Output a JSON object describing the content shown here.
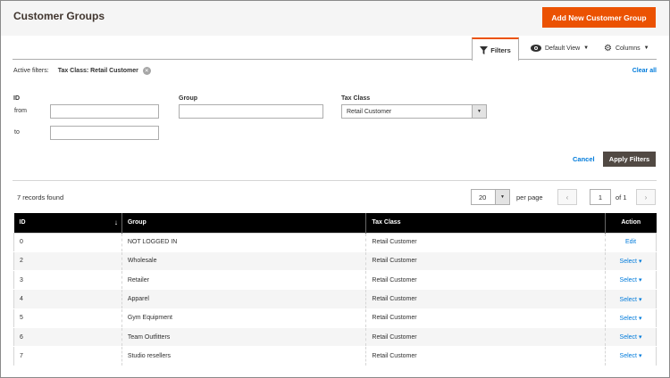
{
  "header": {
    "title": "Customer Groups",
    "add_button": "Add New Customer Group"
  },
  "toolbar": {
    "filters_tab": "Filters",
    "default_view": "Default View",
    "columns": "Columns"
  },
  "active_filters": {
    "label": "Active filters:",
    "chip": "Tax Class: Retail Customer",
    "clear_all": "Clear all"
  },
  "filters": {
    "id_label": "ID",
    "from_label": "from",
    "to_label": "to",
    "from_value": "",
    "to_value": "",
    "group_label": "Group",
    "group_value": "",
    "tax_class_label": "Tax Class",
    "tax_class_value": "Retail Customer",
    "cancel": "Cancel",
    "apply": "Apply Filters"
  },
  "pager": {
    "records_found": "7 records found",
    "per_page_value": "20",
    "per_page_label": "per page",
    "page_value": "1",
    "of_label": "of 1"
  },
  "grid": {
    "columns": [
      "ID",
      "Group",
      "Tax Class",
      "Action"
    ],
    "rows": [
      {
        "id": "0",
        "group": "NOT LOGGED IN",
        "tax_class": "Retail Customer",
        "action": "Edit"
      },
      {
        "id": "2",
        "group": "Wholesale",
        "tax_class": "Retail Customer",
        "action": "Select"
      },
      {
        "id": "3",
        "group": "Retailer",
        "tax_class": "Retail Customer",
        "action": "Select"
      },
      {
        "id": "4",
        "group": "Apparel",
        "tax_class": "Retail Customer",
        "action": "Select"
      },
      {
        "id": "5",
        "group": "Gym Equipment",
        "tax_class": "Retail Customer",
        "action": "Select"
      },
      {
        "id": "6",
        "group": "Team Outfitters",
        "tax_class": "Retail Customer",
        "action": "Select"
      },
      {
        "id": "7",
        "group": "Studio resellers",
        "tax_class": "Retail Customer",
        "action": "Select"
      }
    ]
  },
  "colors": {
    "accent": "#eb5202",
    "link": "#007bdb",
    "dark_button": "#514943"
  }
}
